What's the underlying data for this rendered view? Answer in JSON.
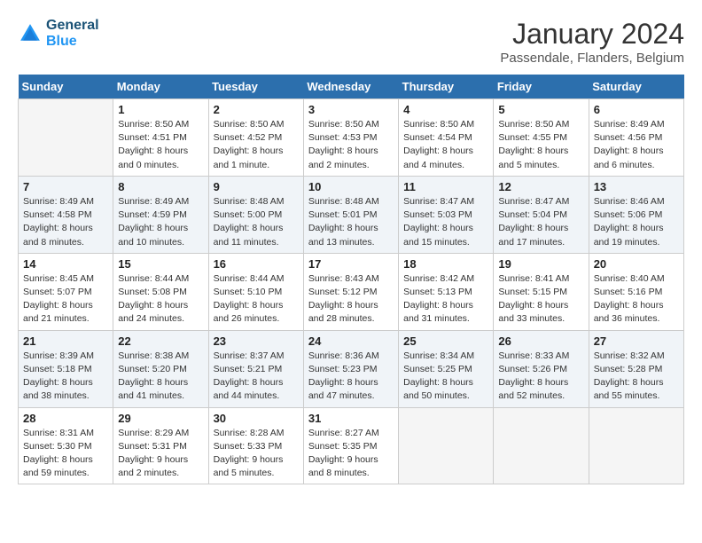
{
  "logo": {
    "line1": "General",
    "line2": "Blue"
  },
  "title": "January 2024",
  "subtitle": "Passendale, Flanders, Belgium",
  "days_of_week": [
    "Sunday",
    "Monday",
    "Tuesday",
    "Wednesday",
    "Thursday",
    "Friday",
    "Saturday"
  ],
  "weeks": [
    [
      {
        "num": "",
        "info": ""
      },
      {
        "num": "1",
        "info": "Sunrise: 8:50 AM\nSunset: 4:51 PM\nDaylight: 8 hours\nand 0 minutes."
      },
      {
        "num": "2",
        "info": "Sunrise: 8:50 AM\nSunset: 4:52 PM\nDaylight: 8 hours\nand 1 minute."
      },
      {
        "num": "3",
        "info": "Sunrise: 8:50 AM\nSunset: 4:53 PM\nDaylight: 8 hours\nand 2 minutes."
      },
      {
        "num": "4",
        "info": "Sunrise: 8:50 AM\nSunset: 4:54 PM\nDaylight: 8 hours\nand 4 minutes."
      },
      {
        "num": "5",
        "info": "Sunrise: 8:50 AM\nSunset: 4:55 PM\nDaylight: 8 hours\nand 5 minutes."
      },
      {
        "num": "6",
        "info": "Sunrise: 8:49 AM\nSunset: 4:56 PM\nDaylight: 8 hours\nand 6 minutes."
      }
    ],
    [
      {
        "num": "7",
        "info": "Sunrise: 8:49 AM\nSunset: 4:58 PM\nDaylight: 8 hours\nand 8 minutes."
      },
      {
        "num": "8",
        "info": "Sunrise: 8:49 AM\nSunset: 4:59 PM\nDaylight: 8 hours\nand 10 minutes."
      },
      {
        "num": "9",
        "info": "Sunrise: 8:48 AM\nSunset: 5:00 PM\nDaylight: 8 hours\nand 11 minutes."
      },
      {
        "num": "10",
        "info": "Sunrise: 8:48 AM\nSunset: 5:01 PM\nDaylight: 8 hours\nand 13 minutes."
      },
      {
        "num": "11",
        "info": "Sunrise: 8:47 AM\nSunset: 5:03 PM\nDaylight: 8 hours\nand 15 minutes."
      },
      {
        "num": "12",
        "info": "Sunrise: 8:47 AM\nSunset: 5:04 PM\nDaylight: 8 hours\nand 17 minutes."
      },
      {
        "num": "13",
        "info": "Sunrise: 8:46 AM\nSunset: 5:06 PM\nDaylight: 8 hours\nand 19 minutes."
      }
    ],
    [
      {
        "num": "14",
        "info": "Sunrise: 8:45 AM\nSunset: 5:07 PM\nDaylight: 8 hours\nand 21 minutes."
      },
      {
        "num": "15",
        "info": "Sunrise: 8:44 AM\nSunset: 5:08 PM\nDaylight: 8 hours\nand 24 minutes."
      },
      {
        "num": "16",
        "info": "Sunrise: 8:44 AM\nSunset: 5:10 PM\nDaylight: 8 hours\nand 26 minutes."
      },
      {
        "num": "17",
        "info": "Sunrise: 8:43 AM\nSunset: 5:12 PM\nDaylight: 8 hours\nand 28 minutes."
      },
      {
        "num": "18",
        "info": "Sunrise: 8:42 AM\nSunset: 5:13 PM\nDaylight: 8 hours\nand 31 minutes."
      },
      {
        "num": "19",
        "info": "Sunrise: 8:41 AM\nSunset: 5:15 PM\nDaylight: 8 hours\nand 33 minutes."
      },
      {
        "num": "20",
        "info": "Sunrise: 8:40 AM\nSunset: 5:16 PM\nDaylight: 8 hours\nand 36 minutes."
      }
    ],
    [
      {
        "num": "21",
        "info": "Sunrise: 8:39 AM\nSunset: 5:18 PM\nDaylight: 8 hours\nand 38 minutes."
      },
      {
        "num": "22",
        "info": "Sunrise: 8:38 AM\nSunset: 5:20 PM\nDaylight: 8 hours\nand 41 minutes."
      },
      {
        "num": "23",
        "info": "Sunrise: 8:37 AM\nSunset: 5:21 PM\nDaylight: 8 hours\nand 44 minutes."
      },
      {
        "num": "24",
        "info": "Sunrise: 8:36 AM\nSunset: 5:23 PM\nDaylight: 8 hours\nand 47 minutes."
      },
      {
        "num": "25",
        "info": "Sunrise: 8:34 AM\nSunset: 5:25 PM\nDaylight: 8 hours\nand 50 minutes."
      },
      {
        "num": "26",
        "info": "Sunrise: 8:33 AM\nSunset: 5:26 PM\nDaylight: 8 hours\nand 52 minutes."
      },
      {
        "num": "27",
        "info": "Sunrise: 8:32 AM\nSunset: 5:28 PM\nDaylight: 8 hours\nand 55 minutes."
      }
    ],
    [
      {
        "num": "28",
        "info": "Sunrise: 8:31 AM\nSunset: 5:30 PM\nDaylight: 8 hours\nand 59 minutes."
      },
      {
        "num": "29",
        "info": "Sunrise: 8:29 AM\nSunset: 5:31 PM\nDaylight: 9 hours\nand 2 minutes."
      },
      {
        "num": "30",
        "info": "Sunrise: 8:28 AM\nSunset: 5:33 PM\nDaylight: 9 hours\nand 5 minutes."
      },
      {
        "num": "31",
        "info": "Sunrise: 8:27 AM\nSunset: 5:35 PM\nDaylight: 9 hours\nand 8 minutes."
      },
      {
        "num": "",
        "info": ""
      },
      {
        "num": "",
        "info": ""
      },
      {
        "num": "",
        "info": ""
      }
    ]
  ]
}
